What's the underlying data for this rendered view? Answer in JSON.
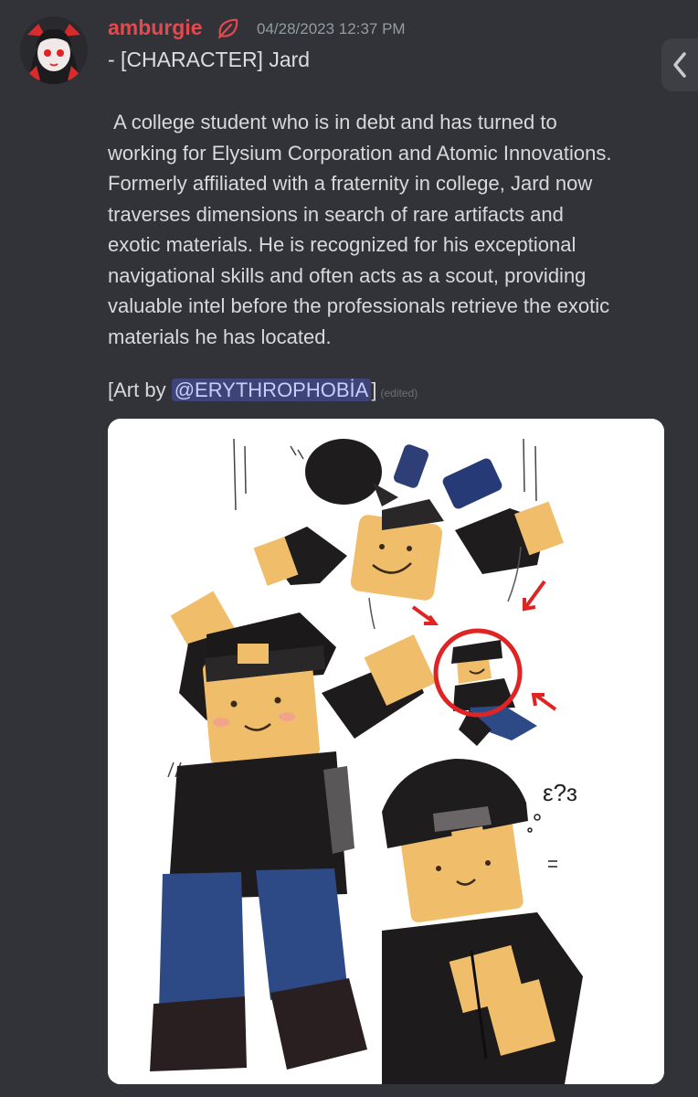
{
  "message": {
    "username": "amburgie",
    "username_color": "#e5484d",
    "badge_icon": "leaf-icon",
    "timestamp": "04/28/2023 12:37 PM",
    "title": "- [CHARACTER] Jard",
    "description": " A college student who is in debt and has turned to\nworking for Elysium Corporation and Atomic Innovations.\nFormerly affiliated with a fraternity in college, Jard now\ntraverses dimensions in search of rare artifacts and\nexotic materials. He is recognized for his exceptional\nnavigational skills and often acts as a scout, providing\nvaluable intel before the professionals retrieve the exotic\nmaterials he has located.",
    "credit_prefix": "[Art by ",
    "credit_mention": "@ERYTHROPHOBİA",
    "credit_suffix": "]",
    "edited_label": "(edited)"
  },
  "art": {
    "doodle_text": "ε?ɜ",
    "background": "#ffffff"
  },
  "sidebar": {
    "toggle_icon": "chevron-left-icon"
  },
  "colors": {
    "background": "#313338",
    "mention_bg": "#5865f2",
    "text": "#dbdee1",
    "muted": "#949ba4"
  }
}
